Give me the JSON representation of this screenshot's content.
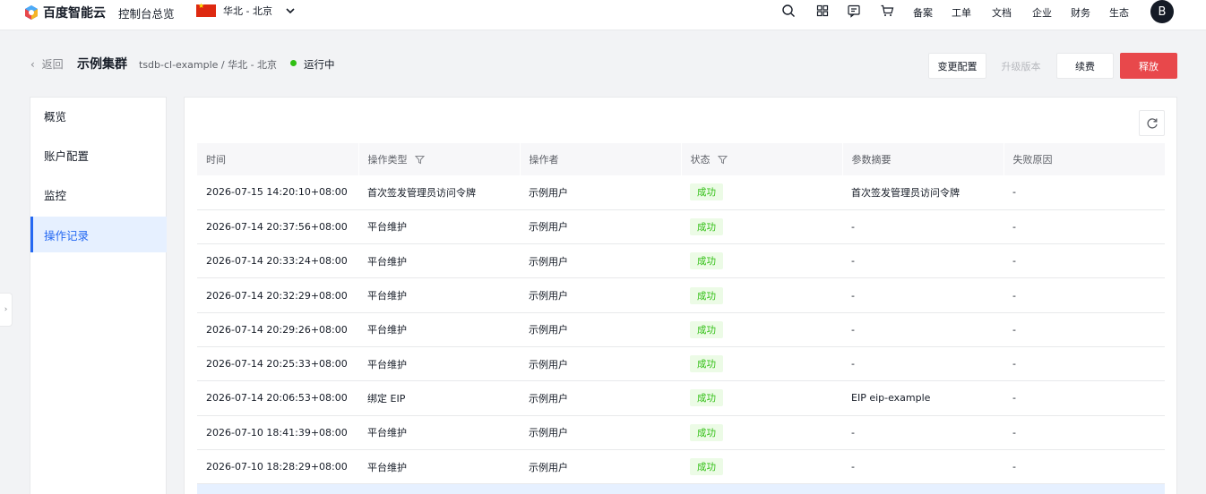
{
  "topbar": {
    "logo_text": "百度智能云",
    "console_title": "控制台总览",
    "region": "华北 - 北京",
    "links": [
      "备案",
      "工单",
      "文档",
      "企业",
      "财务",
      "生态"
    ],
    "avatar_letter": "B"
  },
  "header": {
    "back_label": "返回",
    "cluster_name": "示例集群",
    "cluster_path": "tsdb-cl-example / 华北 - 北京",
    "status": "运行中",
    "status_color": "#30bf13",
    "buttons": {
      "change_config": "变更配置",
      "upgrade": "升级版本",
      "renew": "续费",
      "release": "释放"
    }
  },
  "sidebar": {
    "items": [
      {
        "label": "概览"
      },
      {
        "label": "账户配置"
      },
      {
        "label": "监控"
      },
      {
        "label": "操作记录"
      }
    ],
    "active_index": 3
  },
  "table": {
    "columns": [
      "时间",
      "操作类型",
      "操作者",
      "状态",
      "参数摘要",
      "失败原因"
    ],
    "rows": [
      {
        "time": "2026-07-15 14:20:10+08:00",
        "type": "首次签发管理员访问令牌",
        "operator": "示例用户",
        "status": "成功",
        "params": "首次签发管理员访问令牌",
        "reason": "-"
      },
      {
        "time": "2026-07-14 20:37:56+08:00",
        "type": "平台维护",
        "operator": "示例用户",
        "status": "成功",
        "params": "-",
        "reason": "-"
      },
      {
        "time": "2026-07-14 20:33:24+08:00",
        "type": "平台维护",
        "operator": "示例用户",
        "status": "成功",
        "params": "-",
        "reason": "-"
      },
      {
        "time": "2026-07-14 20:32:29+08:00",
        "type": "平台维护",
        "operator": "示例用户",
        "status": "成功",
        "params": "-",
        "reason": "-"
      },
      {
        "time": "2026-07-14 20:29:26+08:00",
        "type": "平台维护",
        "operator": "示例用户",
        "status": "成功",
        "params": "-",
        "reason": "-"
      },
      {
        "time": "2026-07-14 20:25:33+08:00",
        "type": "平台维护",
        "operator": "示例用户",
        "status": "成功",
        "params": "-",
        "reason": "-"
      },
      {
        "time": "2026-07-14 20:06:53+08:00",
        "type": "绑定 EIP",
        "operator": "示例用户",
        "status": "成功",
        "params": "EIP eip-example",
        "reason": "-"
      },
      {
        "time": "2026-07-10 18:41:39+08:00",
        "type": "平台维护",
        "operator": "示例用户",
        "status": "成功",
        "params": "-",
        "reason": "-"
      },
      {
        "time": "2026-07-10 18:28:29+08:00",
        "type": "平台维护",
        "operator": "示例用户",
        "status": "成功",
        "params": "-",
        "reason": "-"
      }
    ]
  },
  "colors": {
    "primary": "#2468f2",
    "danger": "#e8484b",
    "success": "#30bf13",
    "success_bg": "#ecfbe6"
  }
}
